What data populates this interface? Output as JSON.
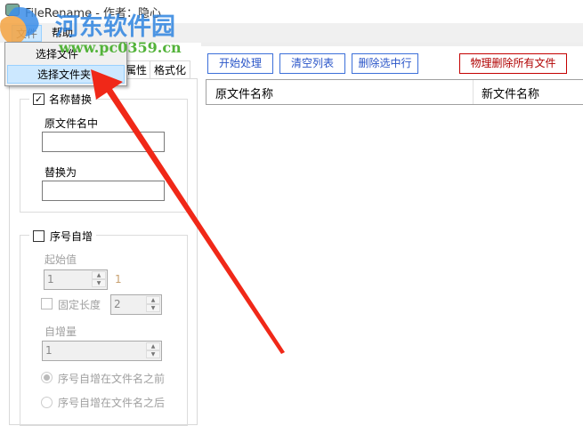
{
  "window": {
    "title": "FileRename - 作者：隐心"
  },
  "watermark": {
    "name": "河东软件园",
    "url": "www.pc0359.cn"
  },
  "menubar": {
    "file": "文件",
    "help": "帮助"
  },
  "file_menu": {
    "items": [
      "选择文件",
      "选择文件夹"
    ]
  },
  "tabs": [
    "属性",
    "格式化"
  ],
  "name_replace": {
    "label": "名称替换",
    "checked": true,
    "find_label": "原文件名中",
    "find_value": "",
    "replace_label": "替换为",
    "replace_value": ""
  },
  "sequence": {
    "label": "序号自增",
    "checked": false,
    "start_label": "起始值",
    "start_value": "1",
    "start_preview": "1",
    "fixed_length_label": "固定长度",
    "fixed_length_value": "2",
    "step_label": "自增量",
    "step_value": "1",
    "radio_before": "序号自增在文件名之前",
    "radio_after": "序号自增在文件名之后"
  },
  "toolbar": {
    "start": "开始处理",
    "clear": "清空列表",
    "delete_selected": "删除选中行",
    "delete_all": "物理删除所有文件"
  },
  "table": {
    "columns": [
      "原文件名称",
      "新文件名称"
    ]
  },
  "colors": {
    "accent": "#3c6fd9",
    "danger": "#c40000",
    "arrow": "#f02818"
  }
}
